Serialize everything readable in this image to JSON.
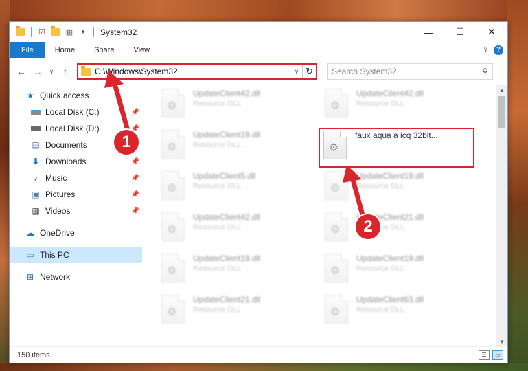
{
  "window": {
    "title": "System32",
    "controls": {
      "minimize": "—",
      "maximize": "☐",
      "close": "✕"
    }
  },
  "ribbon": {
    "tabs": [
      "File",
      "Home",
      "Share",
      "View"
    ],
    "help": "?"
  },
  "navigation": {
    "address": "C:\\Windows\\System32",
    "search_placeholder": "Search System32"
  },
  "sidebar": {
    "quick_access": "Quick access",
    "items": [
      {
        "label": "Local Disk (C:)",
        "icon": "drive-icon",
        "pinned": true
      },
      {
        "label": "Local Disk (D:)",
        "icon": "drive-icon",
        "pinned": true
      },
      {
        "label": "Documents",
        "icon": "documents-icon",
        "pinned": true
      },
      {
        "label": "Downloads",
        "icon": "downloads-icon",
        "pinned": true
      },
      {
        "label": "Music",
        "icon": "music-icon",
        "pinned": true
      },
      {
        "label": "Pictures",
        "icon": "pictures-icon",
        "pinned": true
      },
      {
        "label": "Videos",
        "icon": "videos-icon",
        "pinned": true
      }
    ],
    "onedrive": "OneDrive",
    "this_pc": "This PC",
    "network": "Network"
  },
  "files": {
    "left": [
      {
        "name": "UpdateClient42.dll",
        "type": "Resource DLL"
      },
      {
        "name": "UpdateClient19.dll",
        "type": "Resource DLL"
      },
      {
        "name": "UpdateClient5.dll",
        "type": "Resource DLL"
      },
      {
        "name": "UpdateClient42.dll",
        "type": "Resource DLL"
      },
      {
        "name": "UpdateClient19.dll",
        "type": "Resource DLL"
      },
      {
        "name": "UpdateClient21.dll",
        "type": "Resource DLL"
      }
    ],
    "right": [
      {
        "name": "UpdateClient42.dll",
        "type": "Resource DLL"
      },
      {
        "name": "faux aqua a icq 32bit...",
        "type": ""
      },
      {
        "name": "UpdateClient19.dll",
        "type": "Resource DLL"
      },
      {
        "name": "UpdateClient21.dll",
        "type": "Resource DLL"
      },
      {
        "name": "UpdateClient19.dll",
        "type": "Resource DLL"
      },
      {
        "name": "UpdateClient63.dll",
        "type": "Resource DLL"
      }
    ]
  },
  "status": {
    "item_count": "150 items"
  },
  "callouts": [
    "1",
    "2"
  ],
  "colors": {
    "accent": "#1979ca",
    "highlight": "#d9262c",
    "selection": "#cce8ff"
  }
}
